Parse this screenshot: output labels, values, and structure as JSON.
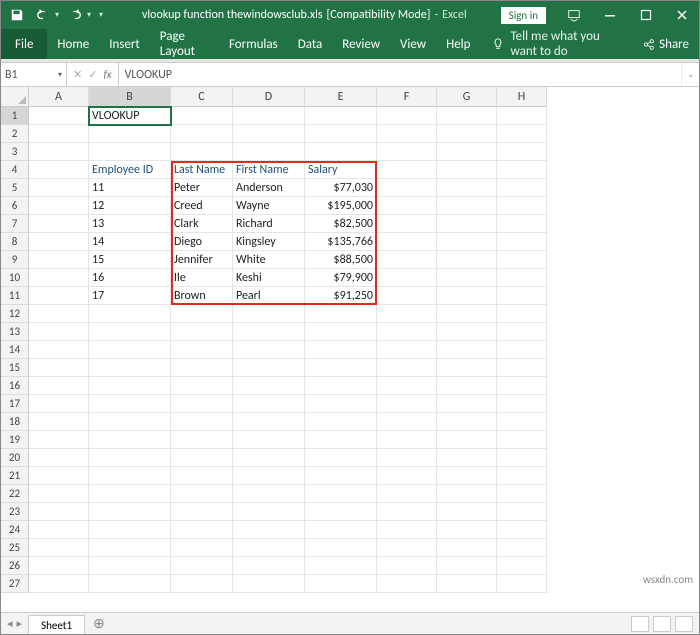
{
  "titlebar": {
    "doc_name": "vlookup function thewindowsclub.xls",
    "mode": "[Compatibility Mode]",
    "app": "Excel",
    "signin": "Sign in"
  },
  "ribbon": {
    "file": "File",
    "tabs": [
      "Home",
      "Insert",
      "Page Layout",
      "Formulas",
      "Data",
      "Review",
      "View",
      "Help"
    ],
    "tell_me": "Tell me what you want to do",
    "share": "Share"
  },
  "formula_bar": {
    "name_box": "B1",
    "content": "VLOOKUP"
  },
  "columns": [
    "A",
    "B",
    "C",
    "D",
    "E",
    "F",
    "G",
    "H"
  ],
  "active_cell": "B1",
  "grid": {
    "b1": "VLOOKUP",
    "headers": {
      "b": "Employee ID",
      "c": "Last Name",
      "d": "First Name",
      "e": "Salary"
    },
    "rows": [
      {
        "b": "11",
        "c": "Peter",
        "d": "Anderson",
        "e": "$77,030"
      },
      {
        "b": "12",
        "c": "Creed",
        "d": "Wayne",
        "e": "$195,000"
      },
      {
        "b": "13",
        "c": "Clark",
        "d": "Richard",
        "e": "$82,500"
      },
      {
        "b": "14",
        "c": "Diego",
        "d": "Kingsley",
        "e": "$135,766"
      },
      {
        "b": "15",
        "c": "Jennifer",
        "d": "White",
        "e": "$88,500"
      },
      {
        "b": "16",
        "c": "Ile",
        "d": "Keshi",
        "e": "$79,900"
      },
      {
        "b": "17",
        "c": "Brown",
        "d": "Pearl",
        "e": "$91,250"
      }
    ]
  },
  "sheet_tab": "Sheet1",
  "watermark": "wsxdn.com"
}
